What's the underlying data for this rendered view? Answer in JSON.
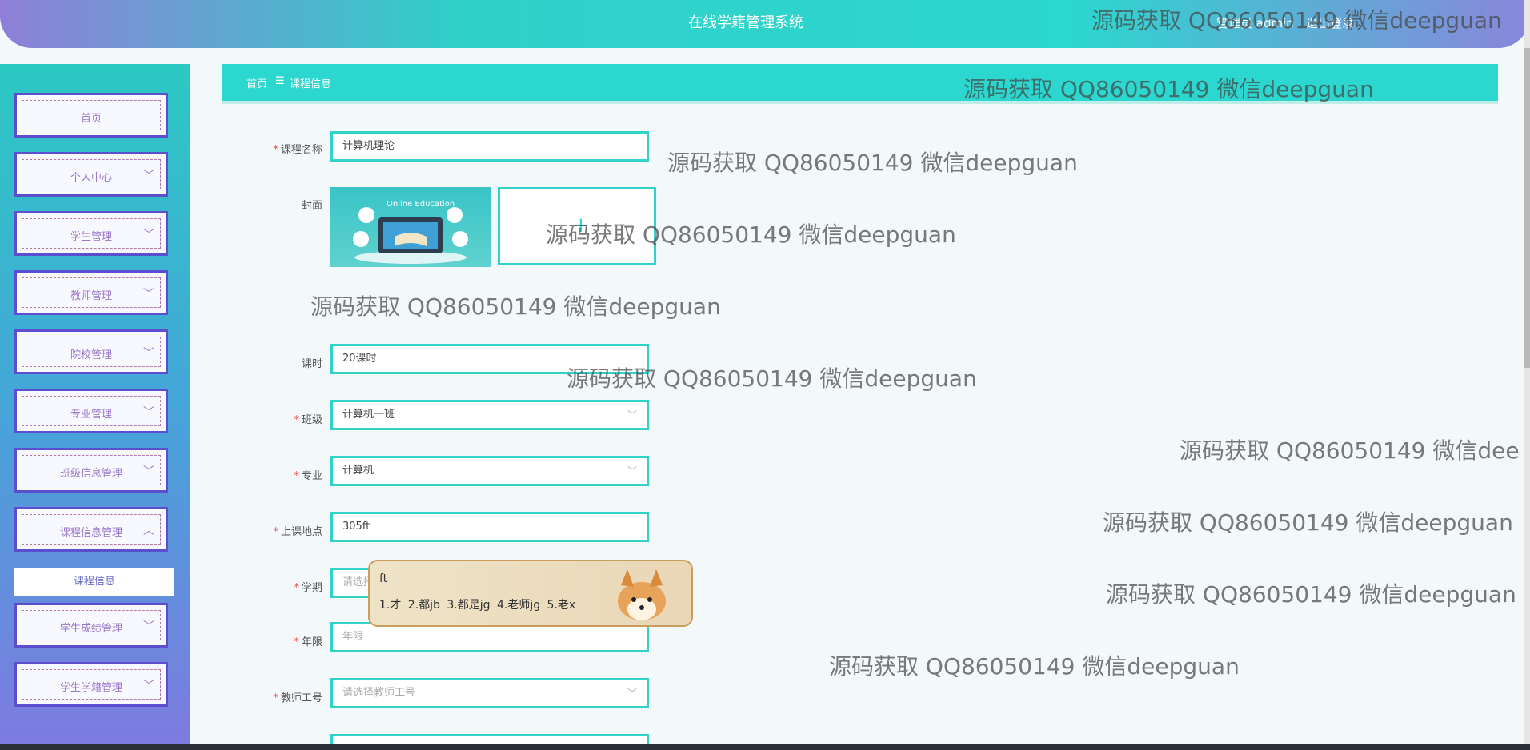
{
  "header": {
    "title": "在线学籍管理系统",
    "user": "管理员 admin",
    "logout": "退出登录"
  },
  "sidebar": {
    "items": [
      {
        "label": "首页",
        "chev": ""
      },
      {
        "label": "个人中心",
        "chev": "﹀"
      },
      {
        "label": "学生管理",
        "chev": "﹀"
      },
      {
        "label": "教师管理",
        "chev": "﹀"
      },
      {
        "label": "院校管理",
        "chev": "﹀"
      },
      {
        "label": "专业管理",
        "chev": "﹀"
      },
      {
        "label": "班级信息管理",
        "chev": "﹀"
      },
      {
        "label": "课程信息管理",
        "chev": "︿"
      },
      {
        "label": "学生成绩管理",
        "chev": "﹀"
      },
      {
        "label": "学生学籍管理",
        "chev": "﹀"
      }
    ],
    "sub_item": "课程信息"
  },
  "breadcrumb": {
    "home": "首页",
    "sep": "☰",
    "current": "课程信息"
  },
  "form": {
    "course_name": {
      "label": "课程名称",
      "value": "计算机理论"
    },
    "cover": {
      "label": "封面"
    },
    "hours": {
      "label": "课时",
      "value": "20课时"
    },
    "class": {
      "label": "班级",
      "value": "计算机一班"
    },
    "major": {
      "label": "专业",
      "value": "计算机"
    },
    "location": {
      "label": "上课地点",
      "value": "305ft"
    },
    "term": {
      "label": "学期",
      "placeholder": "请选择学期"
    },
    "years": {
      "label": "年限",
      "placeholder": "年限"
    },
    "teacher_id": {
      "label": "教师工号",
      "placeholder": "请选择教师工号"
    }
  },
  "cover_image": {
    "text": "Online Education"
  },
  "ime": {
    "input": "ft",
    "candidates": "1.才 2.都jb 3.都是jg 4.老师jg 5.老x"
  },
  "watermarks": [
    "源码获取 QQ86050149 微信deepguan",
    "源码获取 QQ86050149 微信deepguan",
    "源码获取 QQ86050149 微信deepguan",
    "源码获取 QQ86050149 微信deepguan",
    "源码获取 QQ86050149 微信deepguan",
    "源码获取 QQ86050149 微信deepguan",
    "源码获取 QQ86050149 微信dee",
    "源码获取 QQ86050149 微信deepguan",
    "源码获取 QQ86050149 微信deepguan",
    "源码获取 QQ86050149 微信deepguan"
  ],
  "icons": {
    "chevron": "chevron-down-icon",
    "upload": "plus-icon"
  }
}
